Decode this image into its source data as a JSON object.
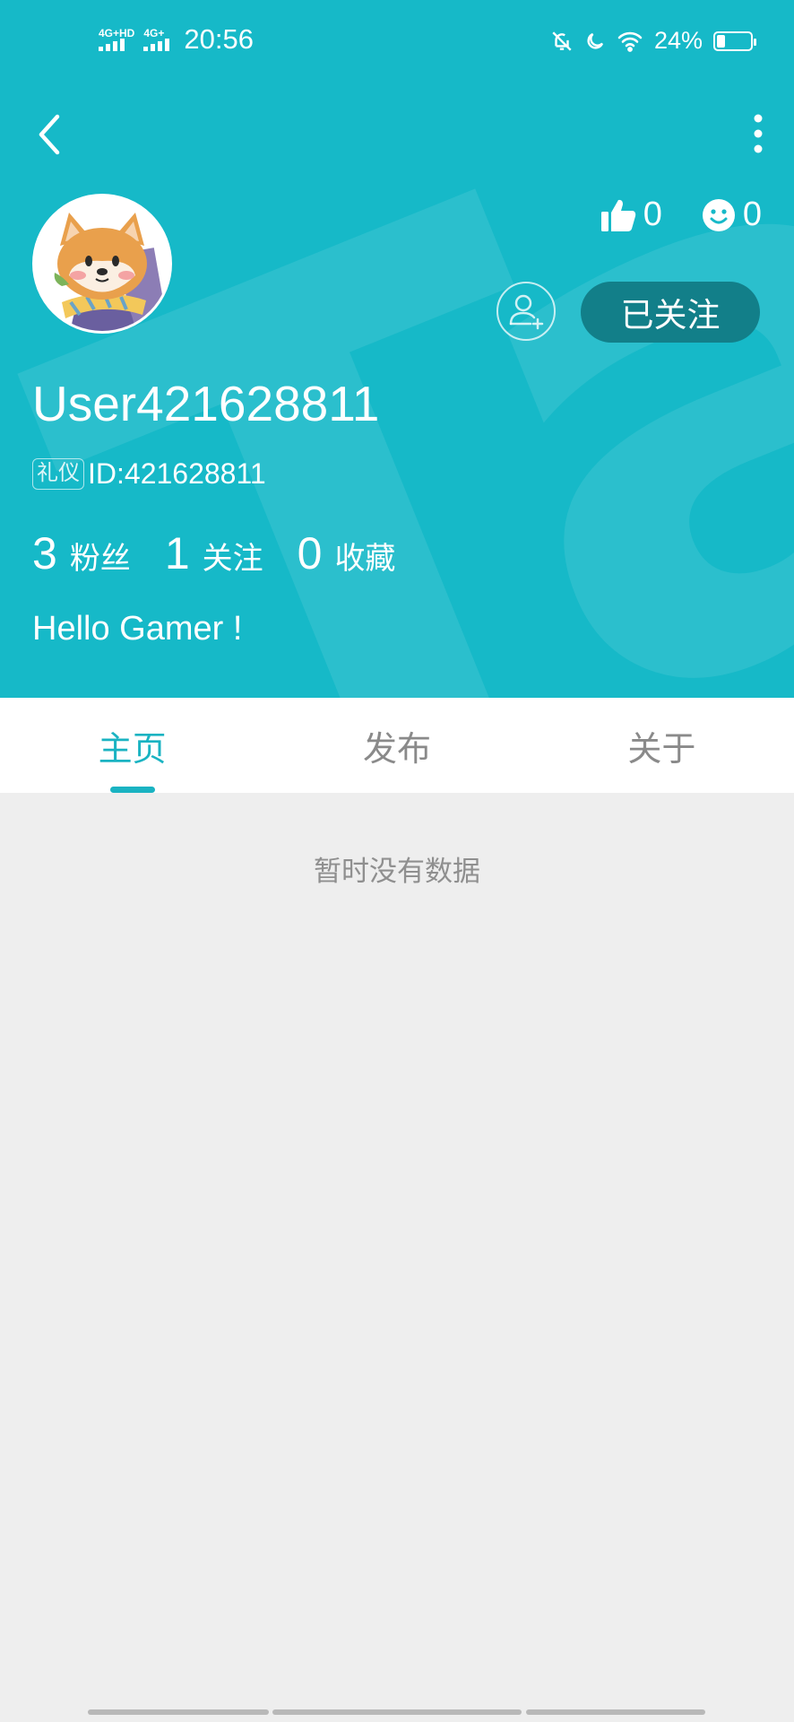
{
  "status_bar": {
    "network1": "4G+HD",
    "network2": "4G+",
    "time": "20:56",
    "battery_percent_text": "24%",
    "battery_level": 0.24
  },
  "colors": {
    "header_bg": "#16b9c8",
    "accent": "#1ab3c2",
    "follow_button_bg": "#127f89",
    "content_bg": "#eeeeee"
  },
  "profile": {
    "likes_count": "0",
    "smiles_count": "0",
    "follow_label": "已关注",
    "username": "User421628811",
    "tag": "礼仪",
    "id_text": "ID:421628811",
    "stats": [
      {
        "value": "3",
        "label": "粉丝"
      },
      {
        "value": "1",
        "label": "关注"
      },
      {
        "value": "0",
        "label": "收藏"
      }
    ],
    "bio": "Hello Gamer !"
  },
  "tabs": [
    {
      "label": "主页",
      "active": true
    },
    {
      "label": "发布",
      "active": false
    },
    {
      "label": "关于",
      "active": false
    }
  ],
  "empty_message": "暂时没有数据",
  "icons": [
    "back-arrow-icon",
    "more-vertical-icon",
    "thumbs-up-icon",
    "smiley-icon",
    "add-user-icon",
    "avatar-shiba-image"
  ]
}
